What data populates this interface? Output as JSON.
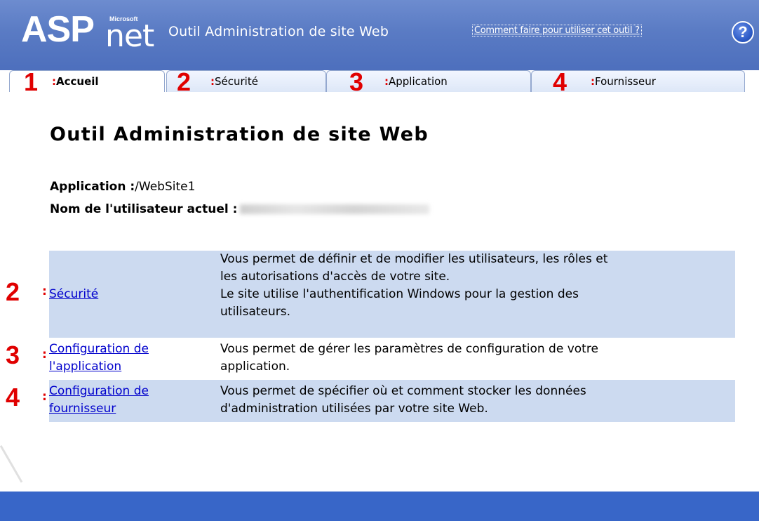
{
  "header": {
    "logo_asp": "ASP",
    "logo_net": "net",
    "logo_microsoft": "Microsoft",
    "title": "Outil Administration de site Web",
    "help_link": "Comment faire pour utiliser cet outil ?",
    "help_icon": "?"
  },
  "tabs": [
    {
      "number": "1",
      "colon": ":",
      "label": "Accueil",
      "active": true
    },
    {
      "number": "2",
      "colon": ":",
      "label": "Sécurité",
      "active": false
    },
    {
      "number": "3",
      "colon": ":",
      "label": "Application",
      "active": false
    },
    {
      "number": "4",
      "colon": ":",
      "label": "Fournisseur",
      "active": false
    }
  ],
  "main": {
    "title": "Outil Administration de site Web",
    "application_label": "Application :",
    "application_value": "/WebSite1",
    "user_label": "Nom de l'utilisateur actuel :"
  },
  "links": [
    {
      "number": "2",
      "colon": ":",
      "link": "Sécurité",
      "description_lines": [
        "Vous permet de définir et de modifier les utilisateurs, les rôles et",
        "les autorisations d'accès de votre site.",
        "Le site utilise l'authentification Windows pour la gestion des",
        "utilisateurs."
      ]
    },
    {
      "number": "3",
      "colon": ":",
      "link_lines": [
        "Configuration de",
        "l'application"
      ],
      "description_lines": [
        "Vous permet de gérer les paramètres de configuration de votre",
        "application."
      ]
    },
    {
      "number": "4",
      "colon": ":",
      "link_lines": [
        "Configuration de",
        "fournisseur"
      ],
      "description_lines": [
        "Vous permet de spécifier où et comment stocker les données",
        "d'administration utilisées par votre site Web."
      ]
    }
  ],
  "colors": {
    "header_blue": "#5a7bc4",
    "footer_blue": "#3866c8",
    "row_shade": "#ccdaf0",
    "annotation_red": "#e00000",
    "link_blue": "#0000cc"
  },
  "icons": {
    "help": "help-circle-icon"
  }
}
